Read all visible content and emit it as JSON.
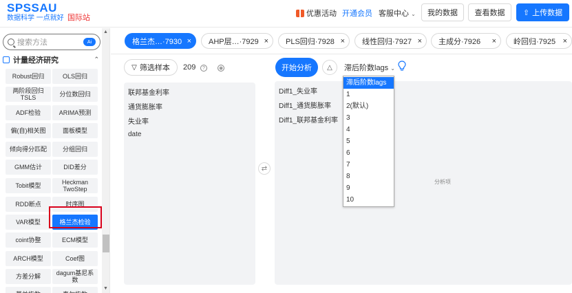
{
  "header": {
    "logo": "SPSSAU",
    "slogan": "数据科学 一点就好",
    "intl": "国际站",
    "promo": "优惠活动",
    "vip": "开通会员",
    "cs": "客服中心",
    "my_data": "我的数据",
    "view_data": "查看数据",
    "upload": "上传数据"
  },
  "sidebar": {
    "search_placeholder": "搜索方法",
    "ai_badge": "Ai",
    "category": "计量经济研究",
    "methods": [
      "Robust回归",
      "OLS回归",
      "两阶段回归\nTSLS",
      "分位数回归",
      "ADF检验",
      "ARIMA预测",
      "偏(自)相关图",
      "面板模型",
      "倾向得分匹配",
      "分组回归",
      "GMM估计",
      "DID差分",
      "Tobit模型",
      "Heckman\nTwoStep",
      "RDD断点",
      "时序图",
      "VAR模型",
      "格兰杰检验",
      "coint协整",
      "ECM模型",
      "ARCH模型",
      "Coef图",
      "方差分解",
      "dagum基尼系\n数",
      "莫兰指数",
      "泰尔指数"
    ]
  },
  "tabs": [
    {
      "label": "格兰杰…·7930",
      "active": true
    },
    {
      "label": "AHP层…·7929",
      "active": false
    },
    {
      "label": "PLS回归·7928",
      "active": false
    },
    {
      "label": "线性回归·7927",
      "active": false
    },
    {
      "label": "主成分·7926",
      "active": false
    },
    {
      "label": "岭回归·7925",
      "active": false
    }
  ],
  "left": {
    "filter": "筛选样本",
    "count": "209",
    "variables": [
      "联邦基金利率",
      "通货膨胀率",
      "失业率",
      "date"
    ]
  },
  "right": {
    "start": "开始分析",
    "lag_select": "滞后阶数lags",
    "analysis_vars": [
      "Diff1_失业率",
      "Diff1_通货膨胀率",
      "Diff1_联邦基金利率"
    ],
    "analysis_label": "分析项"
  },
  "dropdown": {
    "options": [
      "滞后阶数lags",
      "1",
      "2(默认)",
      "3",
      "4",
      "5",
      "6",
      "7",
      "8",
      "9",
      "10"
    ]
  },
  "colors": {
    "accent": "#1677ff",
    "highlight": "#d9001b"
  }
}
